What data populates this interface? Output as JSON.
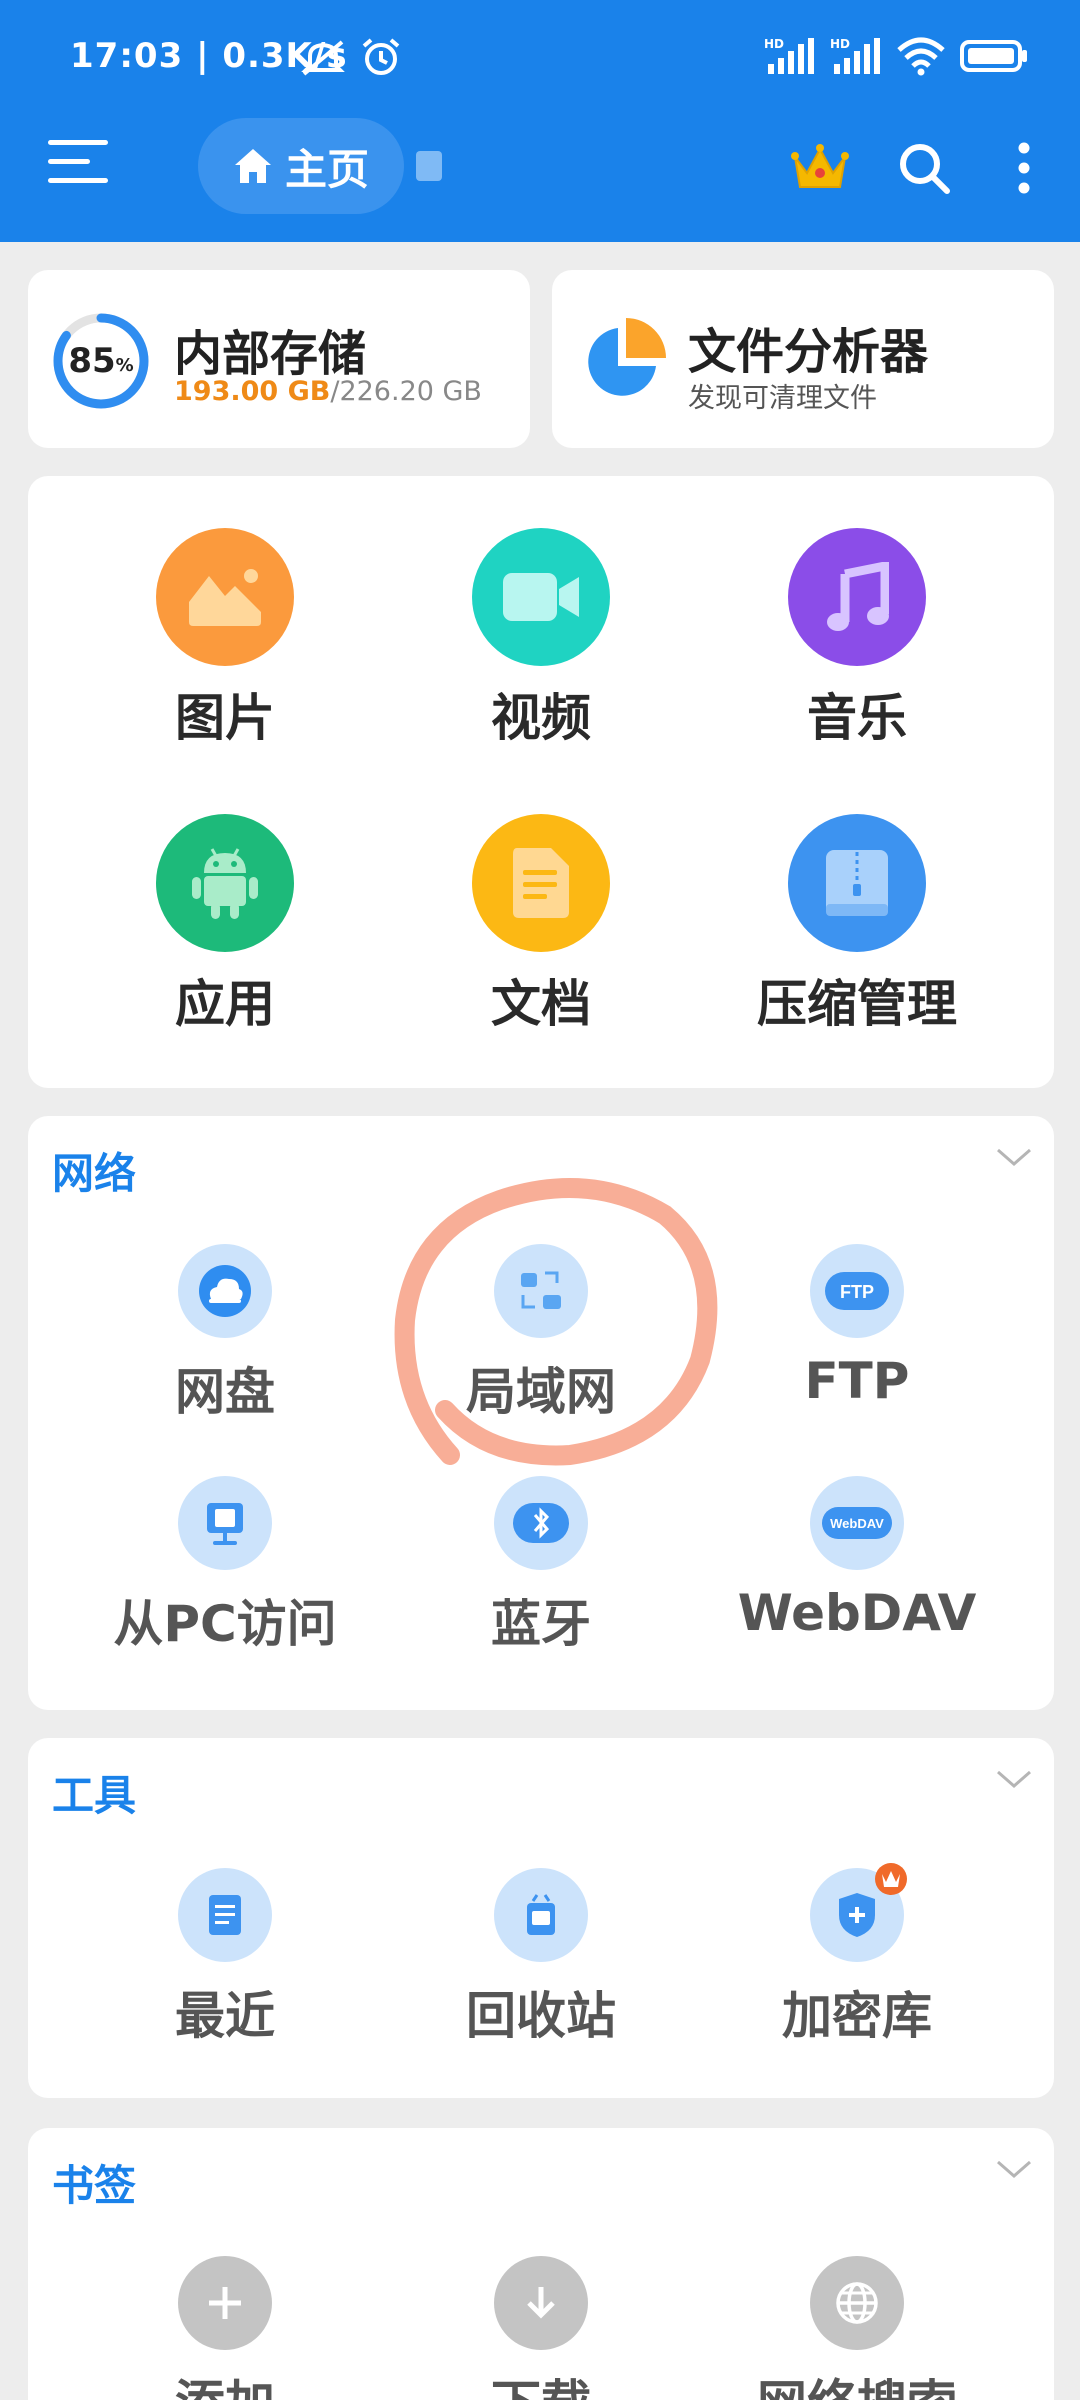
{
  "status_bar": {
    "time": "17:03 | 0.3K/s"
  },
  "toolbar": {
    "home_label": "主页"
  },
  "storage": {
    "percent": "85",
    "percent_sign": "%",
    "title": "内部存储",
    "used": "193.00 GB",
    "separator": "/",
    "total": "226.20 GB",
    "fraction_used": 0.85
  },
  "analyzer": {
    "title": "文件分析器",
    "subtitle": "发现可清理文件"
  },
  "categories": [
    {
      "label": "图片",
      "icon": "image-icon",
      "color": "#fb9a3d"
    },
    {
      "label": "视频",
      "icon": "video-icon",
      "color": "#1fd3c2"
    },
    {
      "label": "音乐",
      "icon": "music-icon",
      "color": "#8b4de8"
    },
    {
      "label": "应用",
      "icon": "android-icon",
      "color": "#1dba7a"
    },
    {
      "label": "文档",
      "icon": "document-icon",
      "color": "#fcb814"
    },
    {
      "label": "压缩管理",
      "icon": "archive-icon",
      "color": "#3d93f0"
    }
  ],
  "network": {
    "title": "网络",
    "items": [
      {
        "label": "网盘",
        "icon": "cloud-drive-icon"
      },
      {
        "label": "局域网",
        "icon": "lan-icon"
      },
      {
        "label": "FTP",
        "icon": "ftp-icon",
        "icon_text": "FTP"
      },
      {
        "label": "从PC访问",
        "icon": "pc-access-icon"
      },
      {
        "label": "蓝牙",
        "icon": "bluetooth-icon"
      },
      {
        "label": "WebDAV",
        "icon": "webdav-icon",
        "icon_text": "WebDAV"
      }
    ]
  },
  "tools": {
    "title": "工具",
    "items": [
      {
        "label": "最近",
        "icon": "recent-icon"
      },
      {
        "label": "回收站",
        "icon": "recycle-bin-icon"
      },
      {
        "label": "加密库",
        "icon": "vault-icon"
      }
    ]
  },
  "bookmarks": {
    "title": "书签",
    "items": [
      {
        "label": "添加",
        "icon": "add-icon"
      },
      {
        "label": "下载",
        "icon": "download-icon"
      },
      {
        "label": "网络搜索",
        "icon": "web-search-icon"
      }
    ]
  },
  "colors": {
    "header": "#1a82ea",
    "accent": "#1a82ea",
    "storage_used": "#ef8a17",
    "annotation": "#f7a58c",
    "premium": "#f5b800"
  }
}
